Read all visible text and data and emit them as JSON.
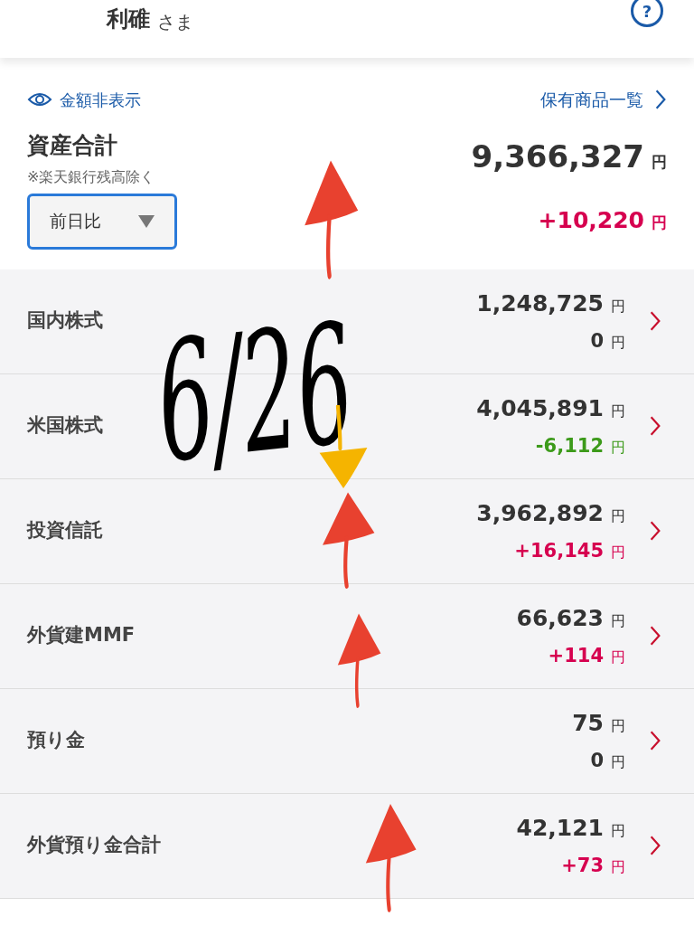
{
  "header": {
    "name": "利碓",
    "honorific": "さま",
    "help": "?"
  },
  "summary": {
    "hide_amounts": "金額非表示",
    "holdings_link": "保有商品一覧",
    "title": "資産合計",
    "note": "※楽天銀行残高除く",
    "compare_select": "前日比",
    "total": "9,366,327",
    "total_unit": "円",
    "change": "+10,220",
    "change_unit": "円"
  },
  "rows": [
    {
      "label": "国内株式",
      "value": "1,248,725",
      "value_unit": "円",
      "change": "0",
      "change_unit": "円",
      "color": "#333333"
    },
    {
      "label": "米国株式",
      "value": "4,045,891",
      "value_unit": "円",
      "change": "-6,112",
      "change_unit": "円",
      "color": "#3c9a1a"
    },
    {
      "label": "投資信託",
      "value": "3,962,892",
      "value_unit": "円",
      "change": "+16,145",
      "change_unit": "円",
      "color": "#d6004f"
    },
    {
      "label": "外貨建MMF",
      "value": "66,623",
      "value_unit": "円",
      "change": "+114",
      "change_unit": "円",
      "color": "#d6004f"
    },
    {
      "label": "預り金",
      "value": "75",
      "value_unit": "円",
      "change": "0",
      "change_unit": "円",
      "color": "#333333"
    },
    {
      "label": "外貨預り金合計",
      "value": "42,121",
      "value_unit": "円",
      "change": "+73",
      "change_unit": "円",
      "color": "#d6004f"
    }
  ],
  "annotations": [
    {
      "kind": "text",
      "text": "6/26"
    },
    {
      "kind": "up_arrow",
      "color": "#e8412f"
    },
    {
      "kind": "down_arrow",
      "color": "#f5b400"
    },
    {
      "kind": "up_arrow",
      "color": "#e8412f"
    },
    {
      "kind": "up_arrow",
      "color": "#e8412f"
    },
    {
      "kind": "up_arrow",
      "color": "#e8412f"
    }
  ]
}
